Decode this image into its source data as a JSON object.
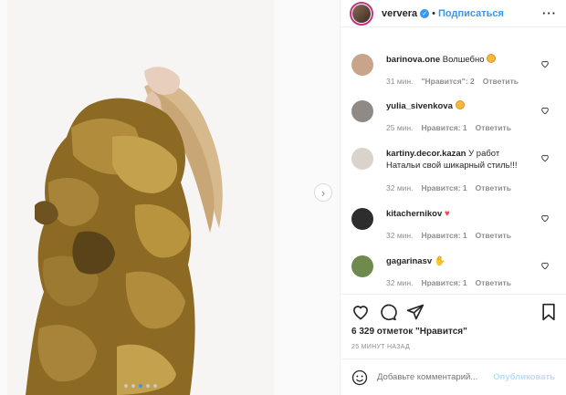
{
  "post": {
    "author": "ververa",
    "separator": "•",
    "follow_label": "Подписаться",
    "more_icon": "more-horizontal-icon",
    "verified_icon": "verified-badge-icon",
    "carousel_total": 5,
    "carousel_active": 3
  },
  "comments": [
    {
      "user": "barinova.one",
      "text": "Волшебно",
      "emoji": "star-struck-emoji",
      "time": "31 мин.",
      "likes": "\"Нравится\": 2",
      "reply": "Ответить",
      "avatar_color": "#c8a58a"
    },
    {
      "user": "yulia_sivenkova",
      "text": "",
      "emoji": "star-struck-emoji",
      "time": "25 мин.",
      "likes": "Нравится: 1",
      "reply": "Ответить",
      "avatar_color": "#8f8a85"
    },
    {
      "user": "kartiny.decor.kazan",
      "text": "У работ Натальи свой шикарный стиль!!!",
      "emoji": "",
      "time": "32 мин.",
      "likes": "Нравится: 1",
      "reply": "Ответить",
      "avatar_color": "#d9d3cc"
    },
    {
      "user": "kitachernikov",
      "text": "",
      "emoji": "red-heart-emoji",
      "time": "32 мин.",
      "likes": "Нравится: 1",
      "reply": "Ответить",
      "avatar_color": "#2d2d2d"
    },
    {
      "user": "gagarinasv",
      "text": "",
      "emoji": "raised-hand-emoji",
      "time": "32 мин.",
      "likes": "Нравится: 1",
      "reply": "Ответить",
      "avatar_color": "#6f8a4d"
    }
  ],
  "actions": {
    "like_icon": "heart-outline-icon",
    "comment_icon": "comment-bubble-icon",
    "share_icon": "paper-plane-icon",
    "save_icon": "bookmark-icon",
    "likes_text": "6 329 отметок \"Нравится\"",
    "time_ago": "25 МИНУТ НАЗАД"
  },
  "add_comment": {
    "placeholder": "Добавьте комментарий...",
    "publish_label": "Опубликовать",
    "emoji_icon": "smiley-icon"
  },
  "colors": {
    "accent": "#3897f0",
    "publish_disabled": "#b2dffc",
    "muted_text": "#8e8e8e",
    "border": "#efefef"
  }
}
